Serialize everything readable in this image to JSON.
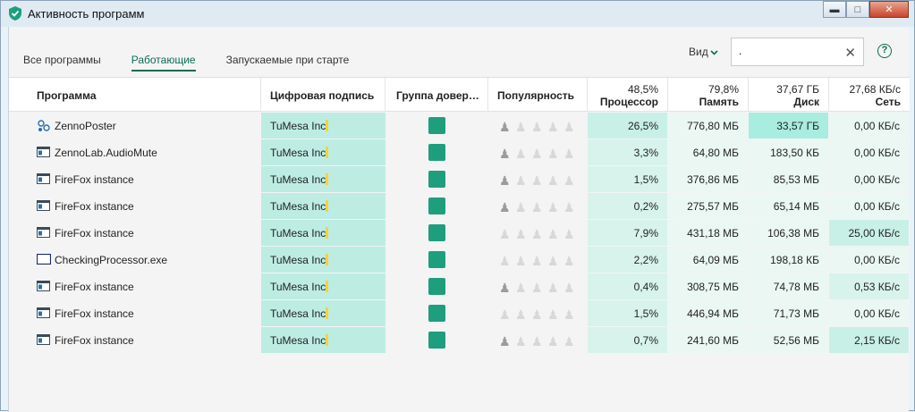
{
  "window": {
    "title": "Активность программ"
  },
  "tabs": [
    {
      "label": "Все программы",
      "active": false
    },
    {
      "label": "Работающие",
      "active": true
    },
    {
      "label": "Запускаемые при старте",
      "active": false
    }
  ],
  "toolbar": {
    "view_label": "Вид",
    "search_value": ".",
    "help_label": "?"
  },
  "columns": {
    "program": "Программа",
    "signature": "Цифровая подпись",
    "group": "Группа довер…",
    "popularity": "Популярность",
    "cpu": {
      "total": "48,5%",
      "label": "Процессор"
    },
    "memory": {
      "total": "79,8%",
      "label": "Память"
    },
    "disk": {
      "total": "37,67 ГБ",
      "label": "Диск"
    },
    "network": {
      "total": "27,68 КБ/с",
      "label": "Сеть"
    }
  },
  "colors": {
    "accent": "#0a6e53",
    "group_trusted": "#1f9e7e",
    "signature_bg": "#bdece3",
    "heat_low": "#eaf7f3",
    "heat_mid": "#d7f3ec",
    "heat_high": "#c8f0e6",
    "heat_max": "#a9ece0"
  },
  "rows": [
    {
      "name": "ZennoPoster",
      "icon": "zennoposter-icon",
      "signature": "TuMesa Inc.",
      "popularity": 1,
      "cpu": "26,5%",
      "memory": "776,80 МБ",
      "disk": "33,57 ГБ",
      "network": "0,00 КБ/с",
      "heat": {
        "cpu": 3,
        "memory": 1,
        "disk": 4,
        "network": 1
      }
    },
    {
      "name": "ZennoLab.AudioMute",
      "icon": "app-window-icon",
      "signature": "TuMesa Inc.",
      "popularity": 1,
      "cpu": "3,3%",
      "memory": "64,80 МБ",
      "disk": "183,50 КБ",
      "network": "0,00 КБ/с",
      "heat": {
        "cpu": 2,
        "memory": 1,
        "disk": 1,
        "network": 1
      }
    },
    {
      "name": "FireFox instance",
      "icon": "app-window-icon",
      "signature": "TuMesa Inc.",
      "popularity": 1,
      "cpu": "1,5%",
      "memory": "376,86 МБ",
      "disk": "85,53 МБ",
      "network": "0,00 КБ/с",
      "heat": {
        "cpu": 2,
        "memory": 1,
        "disk": 1,
        "network": 1
      }
    },
    {
      "name": "FireFox instance",
      "icon": "app-window-icon",
      "signature": "TuMesa Inc.",
      "popularity": 1,
      "cpu": "0,2%",
      "memory": "275,57 МБ",
      "disk": "65,14 МБ",
      "network": "0,00 КБ/с",
      "heat": {
        "cpu": 2,
        "memory": 1,
        "disk": 1,
        "network": 1
      }
    },
    {
      "name": "FireFox instance",
      "icon": "app-window-icon",
      "signature": "TuMesa Inc.",
      "popularity": 0,
      "cpu": "7,9%",
      "memory": "431,18 МБ",
      "disk": "106,38 МБ",
      "network": "25,00 КБ/с",
      "heat": {
        "cpu": 2,
        "memory": 1,
        "disk": 1,
        "network": 3
      }
    },
    {
      "name": "CheckingProcessor.exe",
      "icon": "blank-window-icon",
      "signature": "TuMesa Inc.",
      "popularity": 0,
      "cpu": "2,2%",
      "memory": "64,09 МБ",
      "disk": "198,18 КБ",
      "network": "0,00 КБ/с",
      "heat": {
        "cpu": 2,
        "memory": 1,
        "disk": 1,
        "network": 1
      }
    },
    {
      "name": "FireFox instance",
      "icon": "app-window-icon",
      "signature": "TuMesa Inc.",
      "popularity": 1,
      "cpu": "0,4%",
      "memory": "308,75 МБ",
      "disk": "74,78 МБ",
      "network": "0,53 КБ/с",
      "heat": {
        "cpu": 2,
        "memory": 1,
        "disk": 1,
        "network": 2
      }
    },
    {
      "name": "FireFox instance",
      "icon": "app-window-icon",
      "signature": "TuMesa Inc.",
      "popularity": 0,
      "cpu": "1,5%",
      "memory": "446,94 МБ",
      "disk": "71,73 МБ",
      "network": "0,00 КБ/с",
      "heat": {
        "cpu": 2,
        "memory": 1,
        "disk": 1,
        "network": 1
      }
    },
    {
      "name": "FireFox instance",
      "icon": "app-window-icon",
      "signature": "TuMesa Inc.",
      "popularity": 1,
      "cpu": "0,7%",
      "memory": "241,60 МБ",
      "disk": "52,56 МБ",
      "network": "2,15 КБ/с",
      "heat": {
        "cpu": 2,
        "memory": 1,
        "disk": 1,
        "network": 3
      }
    }
  ]
}
